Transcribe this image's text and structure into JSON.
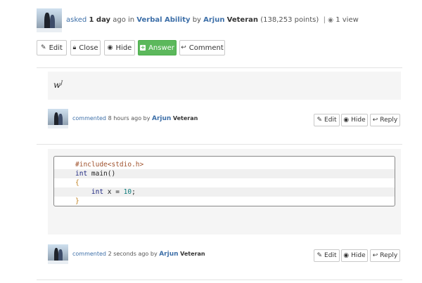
{
  "question_meta": {
    "action": "asked",
    "time": "1 day",
    "ago_in": "ago in",
    "category": "Verbal Ability",
    "by": "by",
    "user": "Arjun",
    "role": "Veteran",
    "points": "(138,253 points)",
    "separator": "|",
    "views": "1 view"
  },
  "actions": {
    "edit": "Edit",
    "close": "Close",
    "hide": "Hide",
    "answer": "Answer",
    "comment": "Comment"
  },
  "comment1": {
    "content": "w",
    "content_sup": "J",
    "action": "commented",
    "time": "8 hours ago",
    "by": "by",
    "user": "Arjun",
    "role": "Veteran",
    "edit": "Edit",
    "hide": "Hide",
    "reply": "Reply"
  },
  "comment2": {
    "code": [
      {
        "parts": [
          {
            "t": "#include<stdio.h>",
            "c": "pre"
          }
        ]
      },
      {
        "parts": [
          {
            "t": "int",
            "c": "kw"
          },
          {
            "t": " main()",
            "c": "def"
          }
        ]
      },
      {
        "parts": [
          {
            "t": "{",
            "c": "br"
          }
        ]
      },
      {
        "parts": [
          {
            "t": "    int",
            "c": "kw"
          },
          {
            "t": " x = ",
            "c": "def"
          },
          {
            "t": "10",
            "c": "num"
          },
          {
            "t": ";",
            "c": "def"
          }
        ]
      },
      {
        "parts": [
          {
            "t": "}",
            "c": "br"
          }
        ]
      }
    ],
    "action": "commented",
    "time": "2 seconds ago",
    "by": "by",
    "user": "Arjun",
    "role": "Veteran",
    "edit": "Edit",
    "hide": "Hide",
    "reply": "Reply"
  },
  "icons": {
    "eye": "eye-icon",
    "pencil": "pencil-icon",
    "lock": "lock-icon",
    "plus": "plus-icon",
    "reply": "reply-icon"
  }
}
